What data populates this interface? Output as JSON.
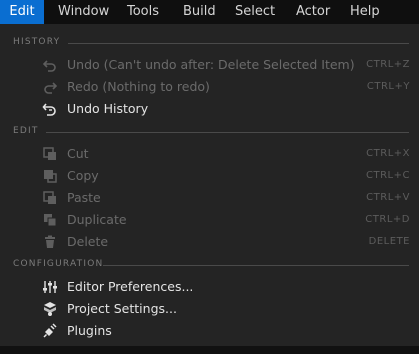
{
  "menubar": {
    "items": [
      {
        "label": "Edit",
        "active": true
      },
      {
        "label": "Window"
      },
      {
        "label": "Tools"
      },
      {
        "label": "Build"
      },
      {
        "label": "Select"
      },
      {
        "label": "Actor"
      },
      {
        "label": "Help"
      }
    ]
  },
  "dropdown": {
    "sections": {
      "history": "HISTORY",
      "edit": "EDIT",
      "configuration": "CONFIGURATION"
    },
    "items": {
      "undo": {
        "label": "Undo (Can't undo after: Delete Selected Item)",
        "shortcut": "CTRL+Z",
        "icon": "undo-icon"
      },
      "redo": {
        "label": "Redo (Nothing to redo)",
        "shortcut": "CTRL+Y",
        "icon": "redo-icon"
      },
      "undo_history": {
        "label": "Undo History",
        "shortcut": "",
        "icon": "undo-history-icon"
      },
      "cut": {
        "label": "Cut",
        "shortcut": "CTRL+X",
        "icon": "cut-icon"
      },
      "copy": {
        "label": "Copy",
        "shortcut": "CTRL+C",
        "icon": "copy-icon"
      },
      "paste": {
        "label": "Paste",
        "shortcut": "CTRL+V",
        "icon": "paste-icon"
      },
      "duplicate": {
        "label": "Duplicate",
        "shortcut": "CTRL+D",
        "icon": "duplicate-icon"
      },
      "delete": {
        "label": "Delete",
        "shortcut": "DELETE",
        "icon": "trash-icon"
      },
      "editor_preferences": {
        "label": "Editor Preferences...",
        "icon": "sliders-icon"
      },
      "project_settings": {
        "label": "Project Settings...",
        "icon": "project-settings-icon"
      },
      "plugins": {
        "label": "Plugins",
        "icon": "plugin-icon"
      }
    }
  },
  "colors": {
    "accent": "#0a6ed1",
    "menu_bg": "#242424",
    "disabled_text": "#6b6b6b",
    "enabled_text": "#e4e4e4"
  }
}
